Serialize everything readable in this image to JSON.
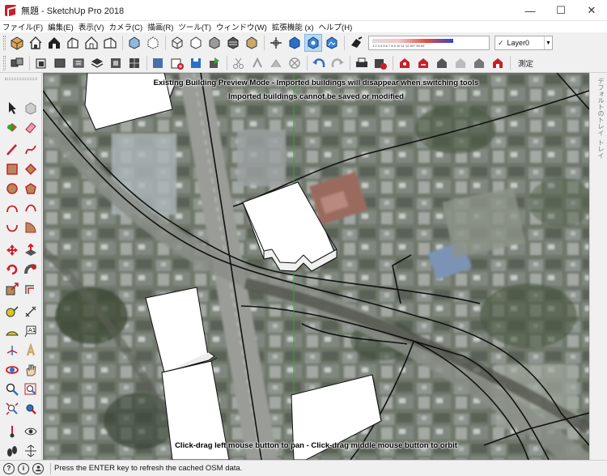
{
  "window": {
    "title": "無題 - SketchUp Pro 2018",
    "controls": {
      "minimize": "—",
      "maximize": "☐",
      "close": "✕"
    }
  },
  "menu": [
    "ファイル(F)",
    "編集(E)",
    "表示(V)",
    "カメラ(C)",
    "描画(R)",
    "ツール(T)",
    "ウィンドウ(W)",
    "拡張機能 (x)",
    "ヘルプ(H)"
  ],
  "toolbar": {
    "layer": "Layer0",
    "layer_check": "✓",
    "scale_ticks": "1 2 3 4 5 6 7 8 9 10 11 12      50+       95.00",
    "measurements_label": "測定"
  },
  "viewport": {
    "overlay_line1": "Existing Building Preview Mode - Imported buildings will disappear when switching tools",
    "overlay_line2": "Imported buildings cannot be saved or modified",
    "overlay_bottom": "Click-drag left mouse button to pan - Click-drag middle mouse button to orbit"
  },
  "right_panel": {
    "tab1": "デフォルトのトレイ",
    "tab2": "トレイ"
  },
  "status": {
    "text": "Press the ENTER key to refresh the cached OSM data.",
    "icons": [
      "?",
      "i",
      "person"
    ]
  },
  "colors": {
    "accent_red": "#c8202a",
    "selected": "#bcd9f2",
    "axis_green": "#2faa2f"
  }
}
